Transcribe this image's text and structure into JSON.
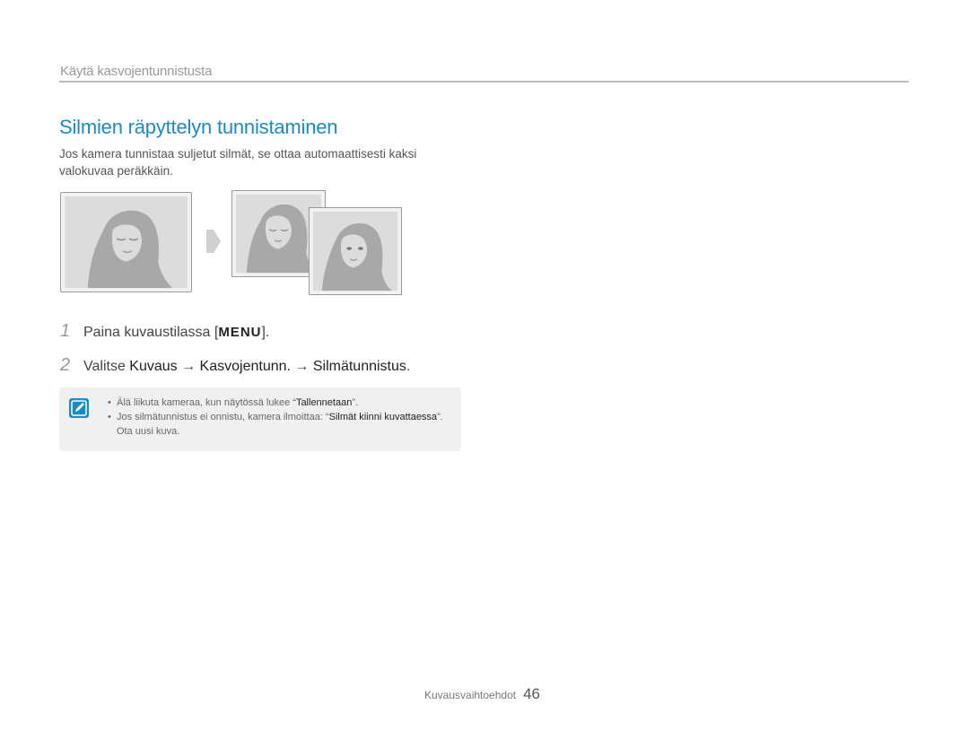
{
  "header": {
    "section_title": "Käytä kasvojentunnistusta"
  },
  "page_title": "Silmien räpyttelyn tunnistaminen",
  "intro": "Jos kamera tunnistaa suljetut silmät, se ottaa automaattisesti kaksi valokuvaa peräkkäin.",
  "steps": [
    {
      "number": "1",
      "prefix": "Paina kuvaustilassa [",
      "key": "MENU",
      "suffix": "]."
    },
    {
      "number": "2",
      "prefix": "Valitse ",
      "part1": "Kuvaus",
      "arrow1": " → ",
      "part2": "Kasvojentunn.",
      "arrow2": " → ",
      "part3": "Silmätunnistus",
      "suffix": "."
    }
  ],
  "note": {
    "icon": "note-pencil-icon",
    "items": [
      {
        "text_before": "Älä liikuta kameraa, kun näytössä lukee “",
        "emphasis": "Tallennetaan",
        "text_after": "”."
      },
      {
        "text_before": "Jos silmätunnistus ei onnistu, kamera ilmoittaa: “",
        "emphasis": "Silmät kiinni kuvattaessa",
        "text_after": "”. Ota uusi kuva."
      }
    ]
  },
  "footer": {
    "label": "Kuvausvaihtoehdot",
    "page_number": "46"
  },
  "colors": {
    "accent": "#1a8bc6",
    "photo_grey": "#a8a8a8"
  }
}
